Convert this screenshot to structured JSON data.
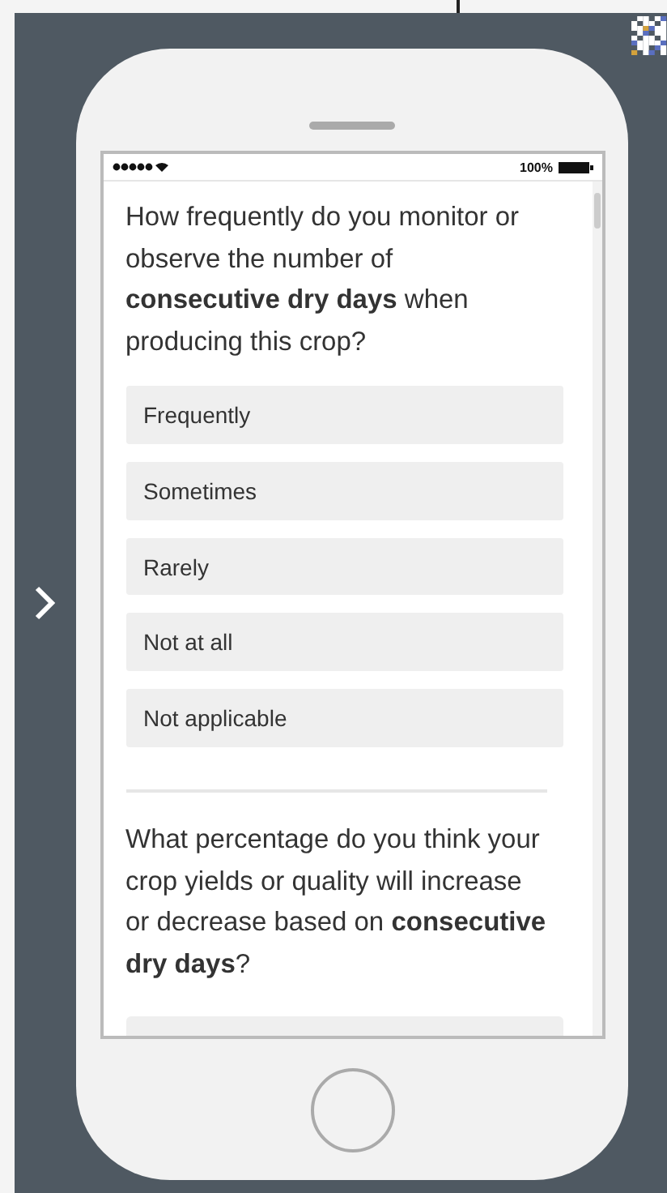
{
  "status_bar": {
    "battery": "100%"
  },
  "questions": [
    {
      "text": "How frequently do you monitor or observe the number of **consecutive dry days** when producing this crop?",
      "options": [
        "Frequently",
        "Sometimes",
        "Rarely",
        "Not at all",
        "Not applicable"
      ]
    },
    {
      "text": "What percentage do you think your crop yields or quality will increase or decrease based on **consecutive dry days**?"
    }
  ]
}
